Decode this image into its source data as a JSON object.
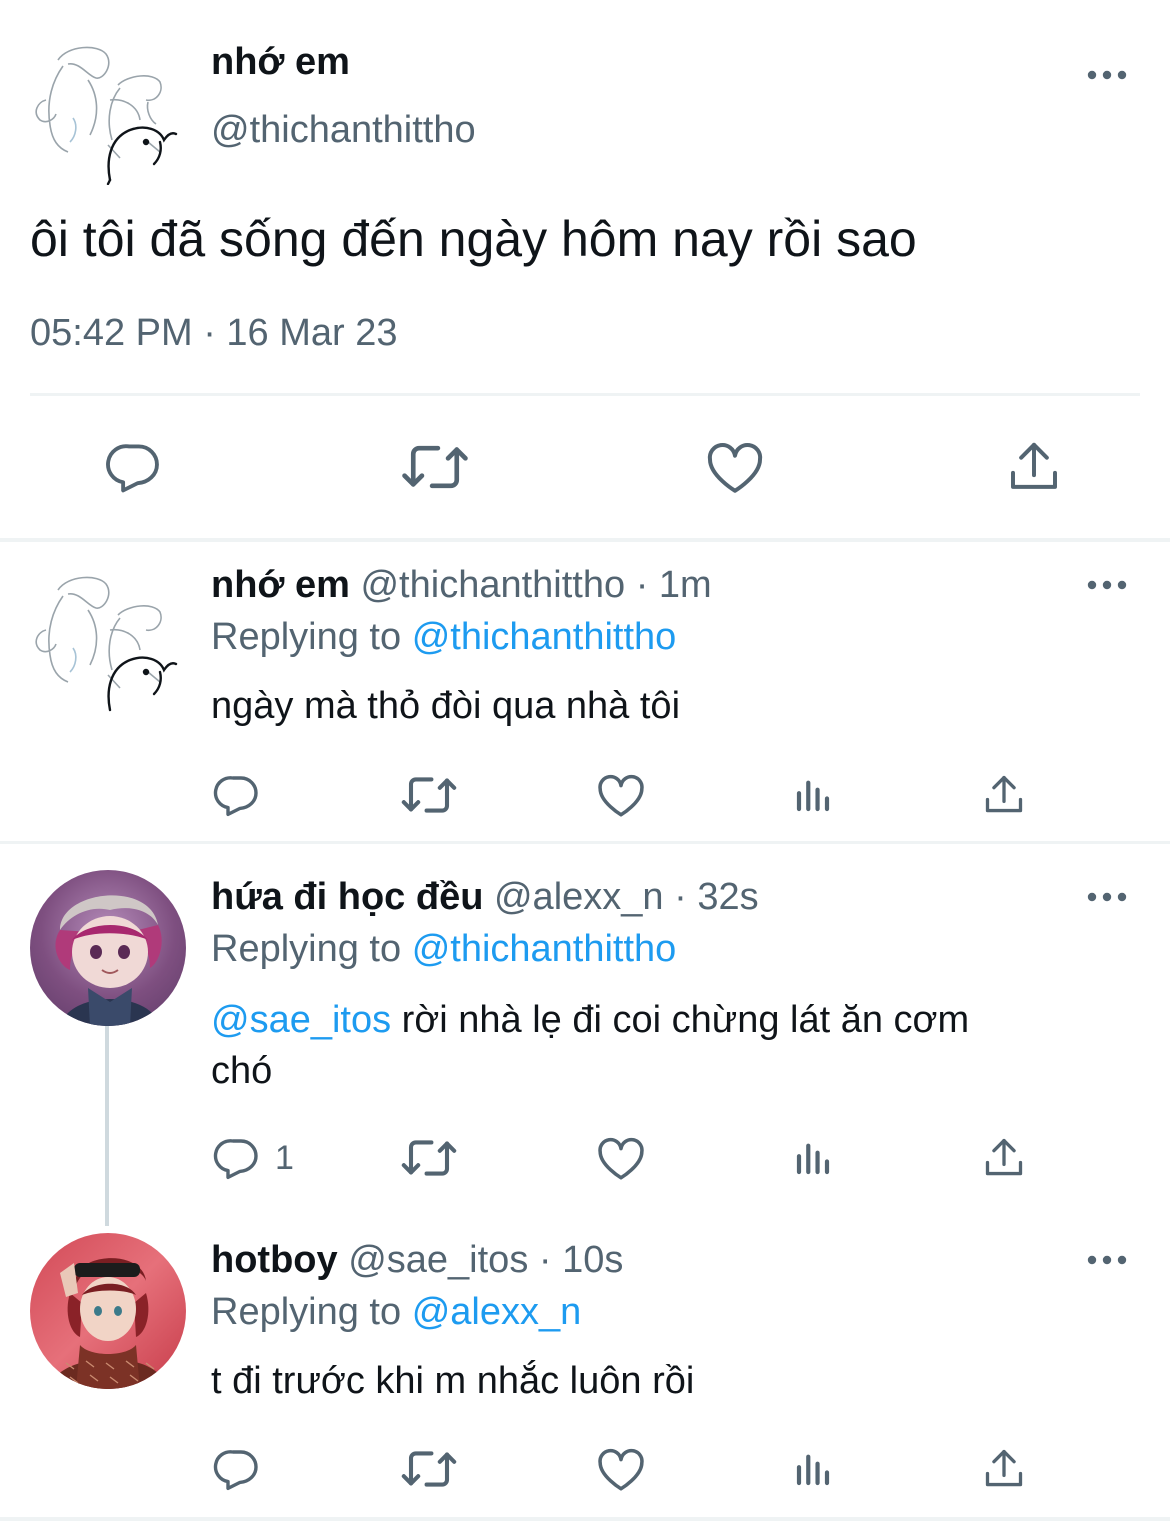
{
  "main_tweet": {
    "display_name": "nhớ em",
    "handle": "@thichanthittho",
    "text": "ôi tôi đã sống đến ngày hôm nay rồi sao",
    "timestamp": "05:42 PM · 16 Mar 23",
    "actions": [
      "reply-icon",
      "retweet-icon",
      "like-icon",
      "share-icon"
    ]
  },
  "replies": [
    {
      "display_name": "nhớ em",
      "handle": "@thichanthittho",
      "time": "· 1m",
      "replying_prefix": "Replying to",
      "replying_to": "@thichanthittho",
      "mention": "",
      "text": "ngày mà thỏ đòi qua nhà tôi",
      "reply_count": ""
    },
    {
      "display_name": "hứa đi học đều",
      "handle": "@alexx_n",
      "time": "· 32s",
      "replying_prefix": "Replying to",
      "replying_to": "@thichanthittho",
      "mention": "@sae_itos",
      "text_line1": " rời nhà lẹ đi coi chừng lát ăn cơm",
      "text_line2": "chó",
      "reply_count": "1"
    },
    {
      "display_name": "hotboy",
      "handle": "@sae_itos",
      "time": "· 10s",
      "replying_prefix": "Replying to",
      "replying_to": "@alexx_n",
      "mention": "",
      "text": "t đi trước khi m nhắc luôn rồi",
      "reply_count": ""
    }
  ],
  "colors": {
    "text": "#0f1419",
    "secondary": "#536471",
    "link": "#1d9bf0",
    "divider": "#eff3f4",
    "avatar2_bg": "#8a5a86",
    "avatar3_bg": "#c8414e"
  }
}
